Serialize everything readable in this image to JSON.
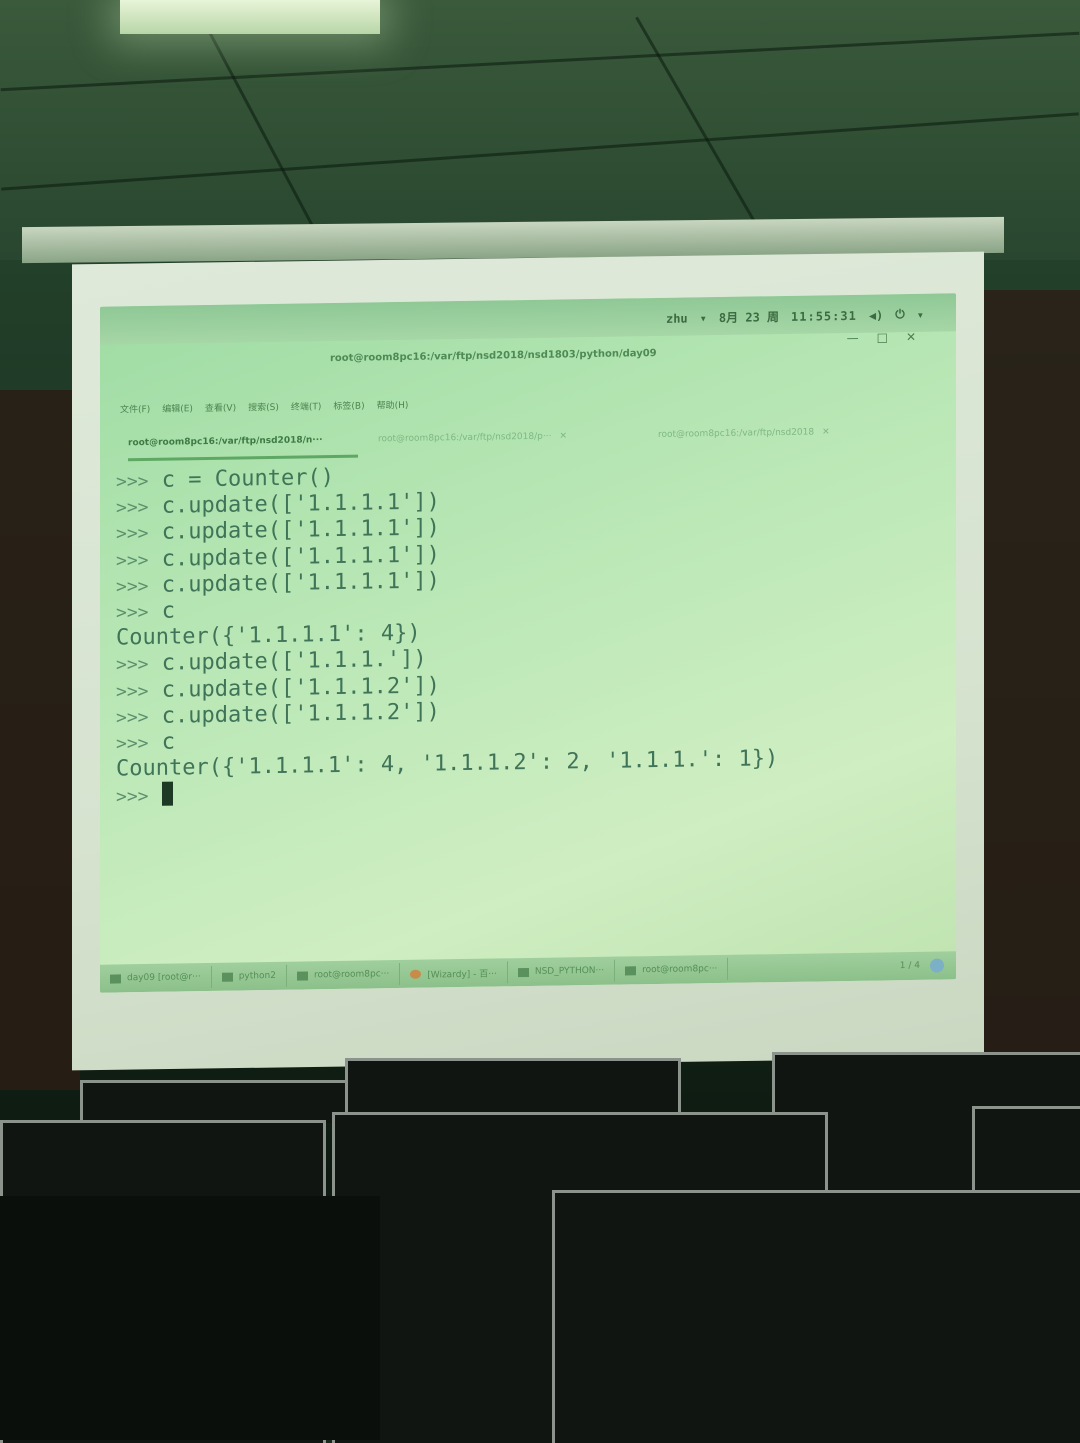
{
  "panel": {
    "user": "zhu",
    "date": "8月 23 周",
    "clock": "11:55:31",
    "volume_icon": "volume-icon",
    "power_icon": "power-icon"
  },
  "window": {
    "title": "root@room8pc16:/var/ftp/nsd2018/nsd1803/python/day09",
    "minimize_icon": "minimize-icon",
    "maximize_icon": "maximize-icon",
    "close_icon": "close-icon"
  },
  "menu": [
    "文件(F)",
    "编辑(E)",
    "查看(V)",
    "搜索(S)",
    "终端(T)",
    "标签(B)",
    "帮助(H)"
  ],
  "tabs": [
    {
      "label": "root@room8pc16:/var/ftp/nsd2018/n···",
      "active": true
    },
    {
      "label": "root@room8pc16:/var/ftp/nsd2018/p···",
      "active": false
    },
    {
      "label": "root@room8pc16:/var/ftp/nsd2018",
      "active": false
    }
  ],
  "terminal": {
    "lines": [
      {
        "prompt": ">>>",
        "text": " c = Counter()"
      },
      {
        "prompt": ">>>",
        "text": " c.update(['1.1.1.1'])"
      },
      {
        "prompt": ">>>",
        "text": " c.update(['1.1.1.1'])"
      },
      {
        "prompt": ">>>",
        "text": " c.update(['1.1.1.1'])"
      },
      {
        "prompt": ">>>",
        "text": " c.update(['1.1.1.1'])"
      },
      {
        "prompt": ">>>",
        "text": " c"
      },
      {
        "prompt": "",
        "text": "Counter({'1.1.1.1': 4})"
      },
      {
        "prompt": ">>>",
        "text": " c.update(['1.1.1.'])"
      },
      {
        "prompt": ">>>",
        "text": " c.update(['1.1.1.2'])"
      },
      {
        "prompt": ">>>",
        "text": " c.update(['1.1.1.2'])"
      },
      {
        "prompt": ">>>",
        "text": " c"
      },
      {
        "prompt": "",
        "text": "Counter({'1.1.1.1': 4, '1.1.1.2': 2, '1.1.1.': 1})"
      },
      {
        "prompt": ">>>",
        "text": " "
      }
    ]
  },
  "taskbar": {
    "items": [
      "day09 [root@r···",
      "python2",
      "root@room8pc···",
      "[Wizardy] - 百···",
      "NSD_PYTHON···",
      "root@room8pc···"
    ],
    "pager": "1 / 4"
  }
}
